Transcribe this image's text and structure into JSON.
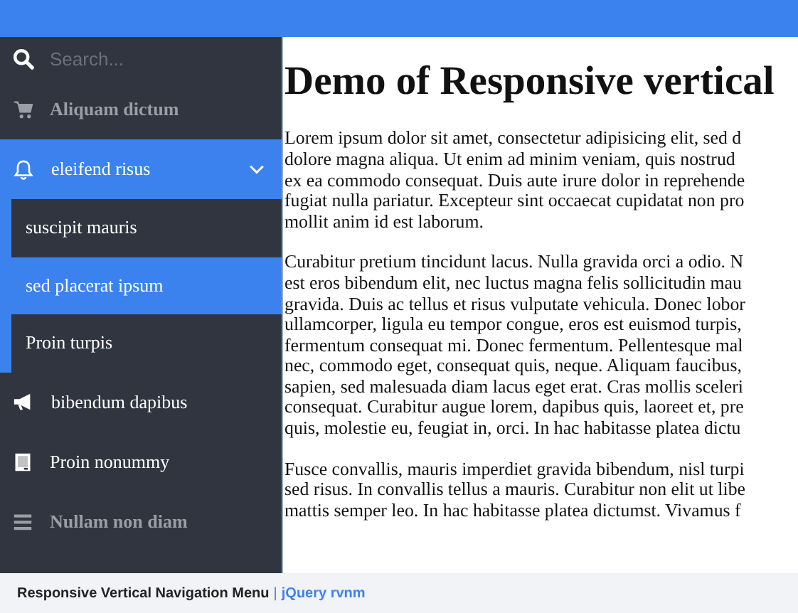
{
  "sidebar": {
    "search": {
      "placeholder": "Search..."
    },
    "items": [
      {
        "label": "Aliquam dictum",
        "disabled": true,
        "selected": false,
        "expanded": false
      },
      {
        "label": "eleifend risus",
        "disabled": false,
        "selected": true,
        "expanded": true,
        "children": [
          {
            "label": "suscipit mauris",
            "selected": false
          },
          {
            "label": "sed placerat ipsum",
            "selected": true
          },
          {
            "label": "Proin turpis",
            "selected": false
          }
        ]
      },
      {
        "label": "bibendum dapibus",
        "disabled": false,
        "selected": false,
        "expanded": false
      },
      {
        "label": "Proin nonummy",
        "disabled": false,
        "selected": false,
        "expanded": false
      },
      {
        "label": "Nullam non diam",
        "disabled": true,
        "selected": false,
        "expanded": false
      }
    ]
  },
  "content": {
    "heading": "Demo of Responsive vertical",
    "paragraphs": [
      [
        "Lorem ipsum dolor sit amet, consectetur adipisicing elit, sed d",
        "dolore magna aliqua. Ut enim ad minim veniam, quis nostrud",
        "ex ea commodo consequat. Duis aute irure dolor in reprehende",
        "fugiat nulla pariatur. Excepteur sint occaecat cupidatat non pro",
        "mollit anim id est laborum."
      ],
      [
        "Curabitur pretium tincidunt lacus. Nulla gravida orci a odio. N",
        "est eros bibendum elit, nec luctus magna felis sollicitudin mau",
        "gravida. Duis ac tellus et risus vulputate vehicula. Donec lobor",
        "ullamcorper, ligula eu tempor congue, eros est euismod turpis,",
        "fermentum consequat mi. Donec fermentum. Pellentesque mal",
        "nec, commodo eget, consequat quis, neque. Aliquam faucibus,",
        "sapien, sed malesuada diam lacus eget erat. Cras mollis sceleri",
        "consequat. Curabitur augue lorem, dapibus quis, laoreet et, pre",
        "quis, molestie eu, feugiat in, orci. In hac habitasse platea dictu"
      ],
      [
        "Fusce convallis, mauris imperdiet gravida bibendum, nisl turpi",
        "sed risus. In convallis tellus a mauris. Curabitur non elit ut libe",
        "mattis semper leo. In hac habitasse platea dictumst. Vivamus f"
      ]
    ]
  },
  "footer": {
    "caption": "Responsive Vertical Navigation Menu",
    "separator": "|",
    "link": "jQuery rvnm"
  }
}
